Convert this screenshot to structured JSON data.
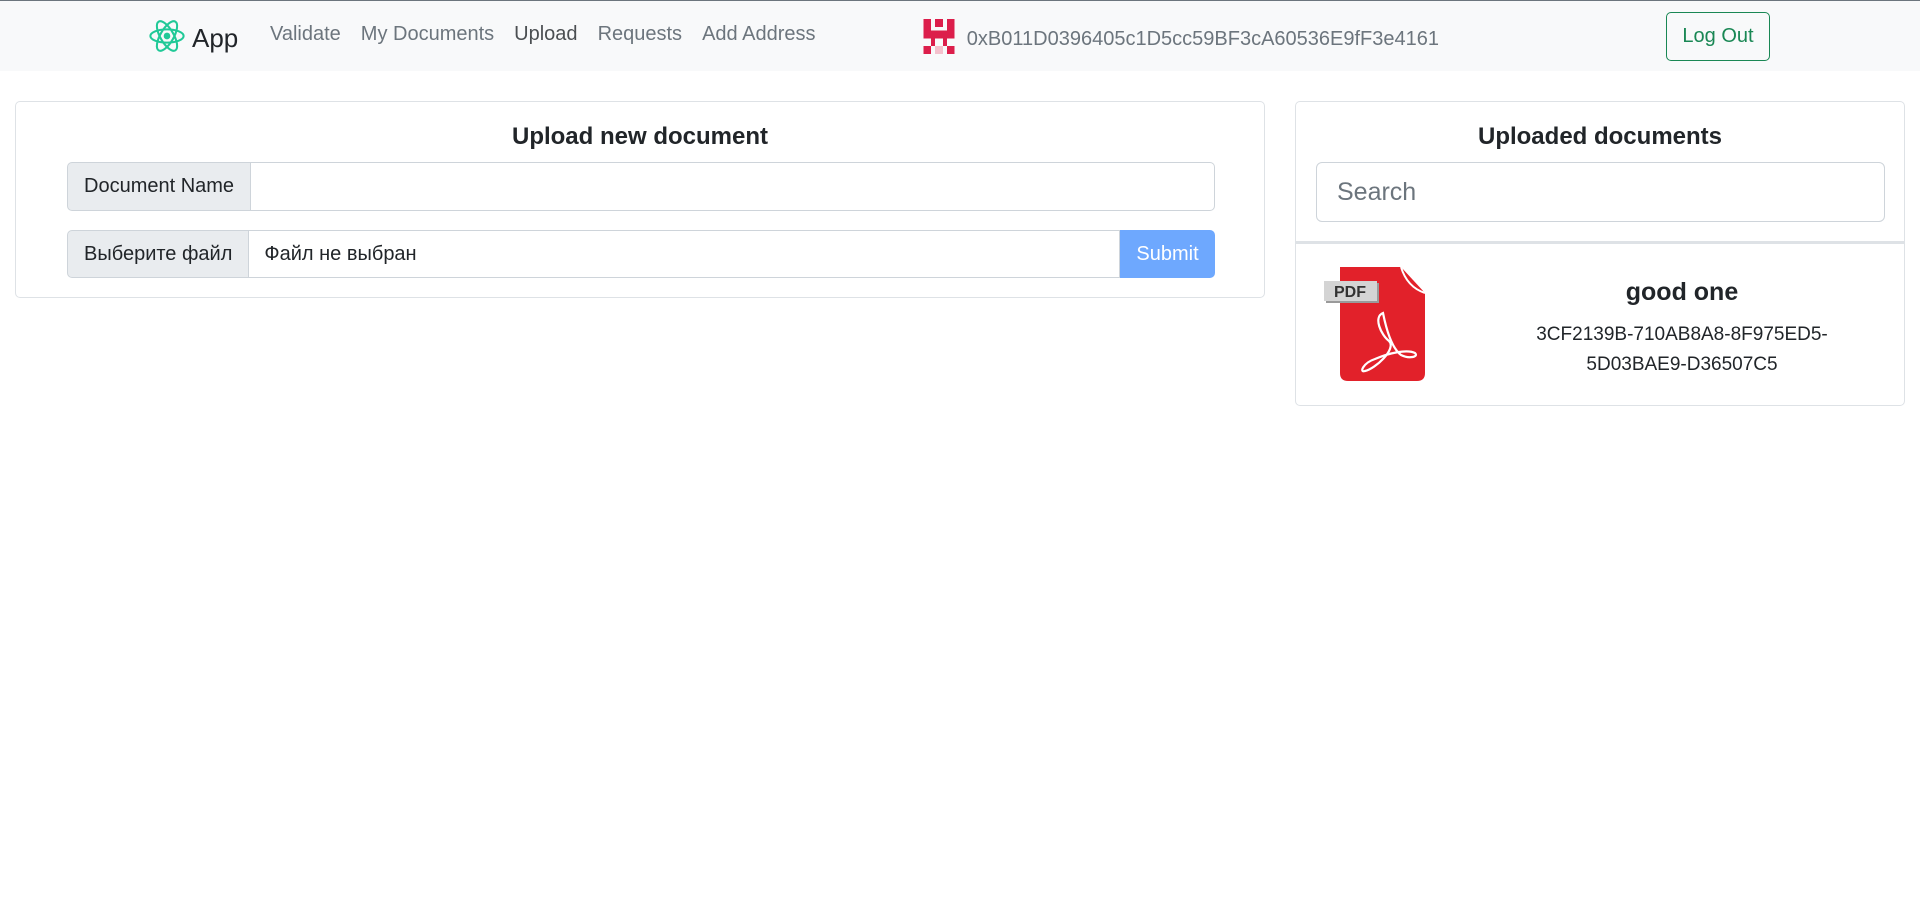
{
  "navbar": {
    "brand": "App",
    "links": [
      "Validate",
      "My Documents",
      "Upload",
      "Requests",
      "Add Address"
    ],
    "active_link": "Upload",
    "account_address": "0xB011D0396405c1D5cc59BF3cA60536E9fF3e4161",
    "logout_label": "Log Out",
    "brand_color": "#20c997"
  },
  "upload_form": {
    "title": "Upload new document",
    "document_name_label": "Document Name",
    "document_name_value": "",
    "file_button_label": "Выберите файл",
    "file_status": "Файл не выбран",
    "submit_label": "Submit",
    "submit_color": "#6ea8fe"
  },
  "documents_panel": {
    "title": "Uploaded documents",
    "search_placeholder": "Search",
    "items": [
      {
        "name": "good one",
        "hash_line1": "3CF2139B-710AB8A8-8F975ED5-",
        "hash_line2": "5D03BAE9-D36507C5",
        "icon": "pdf-icon"
      }
    ]
  }
}
